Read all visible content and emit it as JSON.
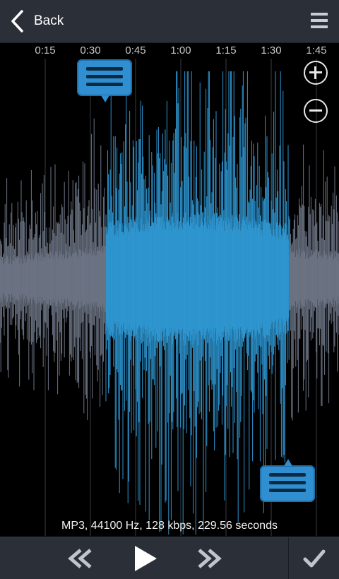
{
  "header": {
    "back_label": "Back",
    "back_icon": "chevron-left-icon",
    "menu_icon": "hamburger-menu-icon"
  },
  "timeline": {
    "ticks": [
      "0:15",
      "0:30",
      "0:45",
      "1:00",
      "1:15",
      "1:30",
      "1:45"
    ]
  },
  "waveform": {
    "unselected_color": "#6b7383",
    "selected_color": "#2e95cf"
  },
  "zoom": {
    "in_icon": "zoom-in-icon",
    "out_icon": "zoom-out-icon"
  },
  "info": {
    "text": "MP3, 44100 Hz, 128 kbps, 229.56 seconds"
  },
  "controls": {
    "rewind_icon": "rewind-icon",
    "play_icon": "play-icon",
    "forward_icon": "fast-forward-icon",
    "confirm_icon": "checkmark-icon"
  }
}
